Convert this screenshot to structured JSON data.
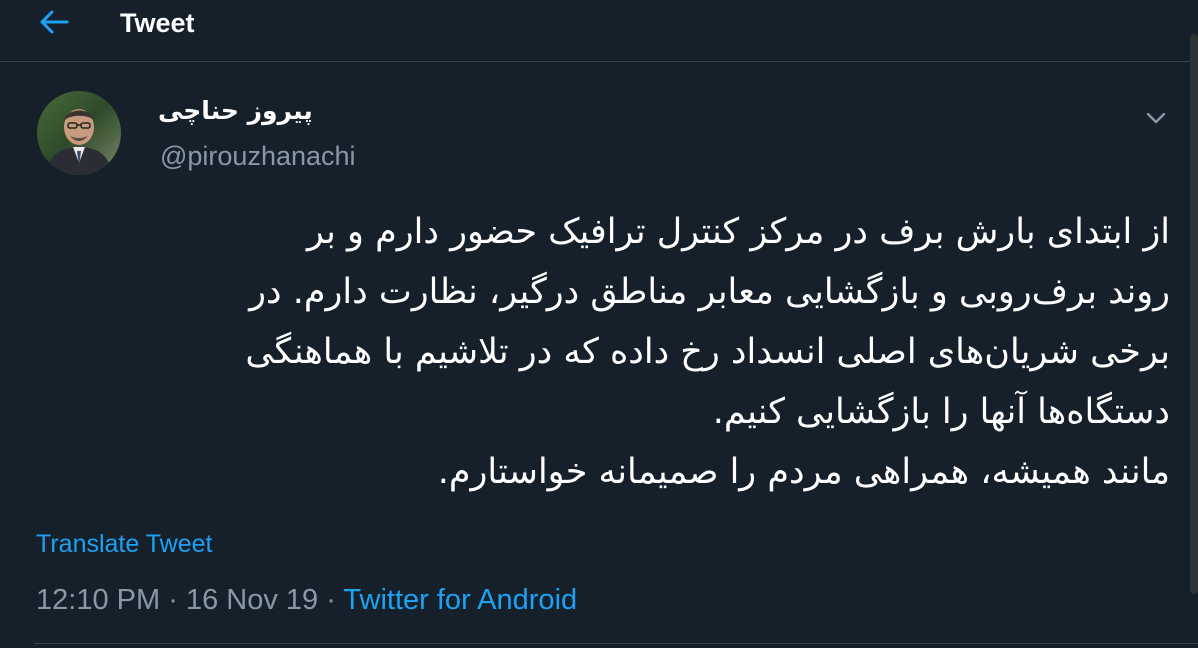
{
  "header": {
    "back_icon": "arrow-left-icon",
    "title": "Tweet"
  },
  "tweet": {
    "author_name": "پیروز حناچی",
    "handle": "@pirouzhanachi",
    "avatar_icon": "user-avatar",
    "caret_icon": "chevron-down-icon",
    "text_lines": [
      "از ابتدای بارش برف در مرکز کنترل ترافیک حضور دارم و بر",
      "روند برف‌روبی و بازگشایی معابر مناطق درگیر، نظارت دارم. در",
      "برخی شریان‌های اصلی انسداد رخ داده که در تلاشیم با هماهنگی",
      "دستگاه‌ها آنها را بازگشایی کنیم.",
      "مانند همیشه، همراهی مردم را صمیمانه خواستارم."
    ],
    "translate_label": "Translate Tweet",
    "time": "12:10 PM",
    "separator": "·",
    "date": "16 Nov 19",
    "source": "Twitter for Android"
  },
  "colors": {
    "background": "#15202b",
    "accent": "#1da1f2",
    "secondary_text": "#8899a6",
    "divider": "#38444d"
  }
}
